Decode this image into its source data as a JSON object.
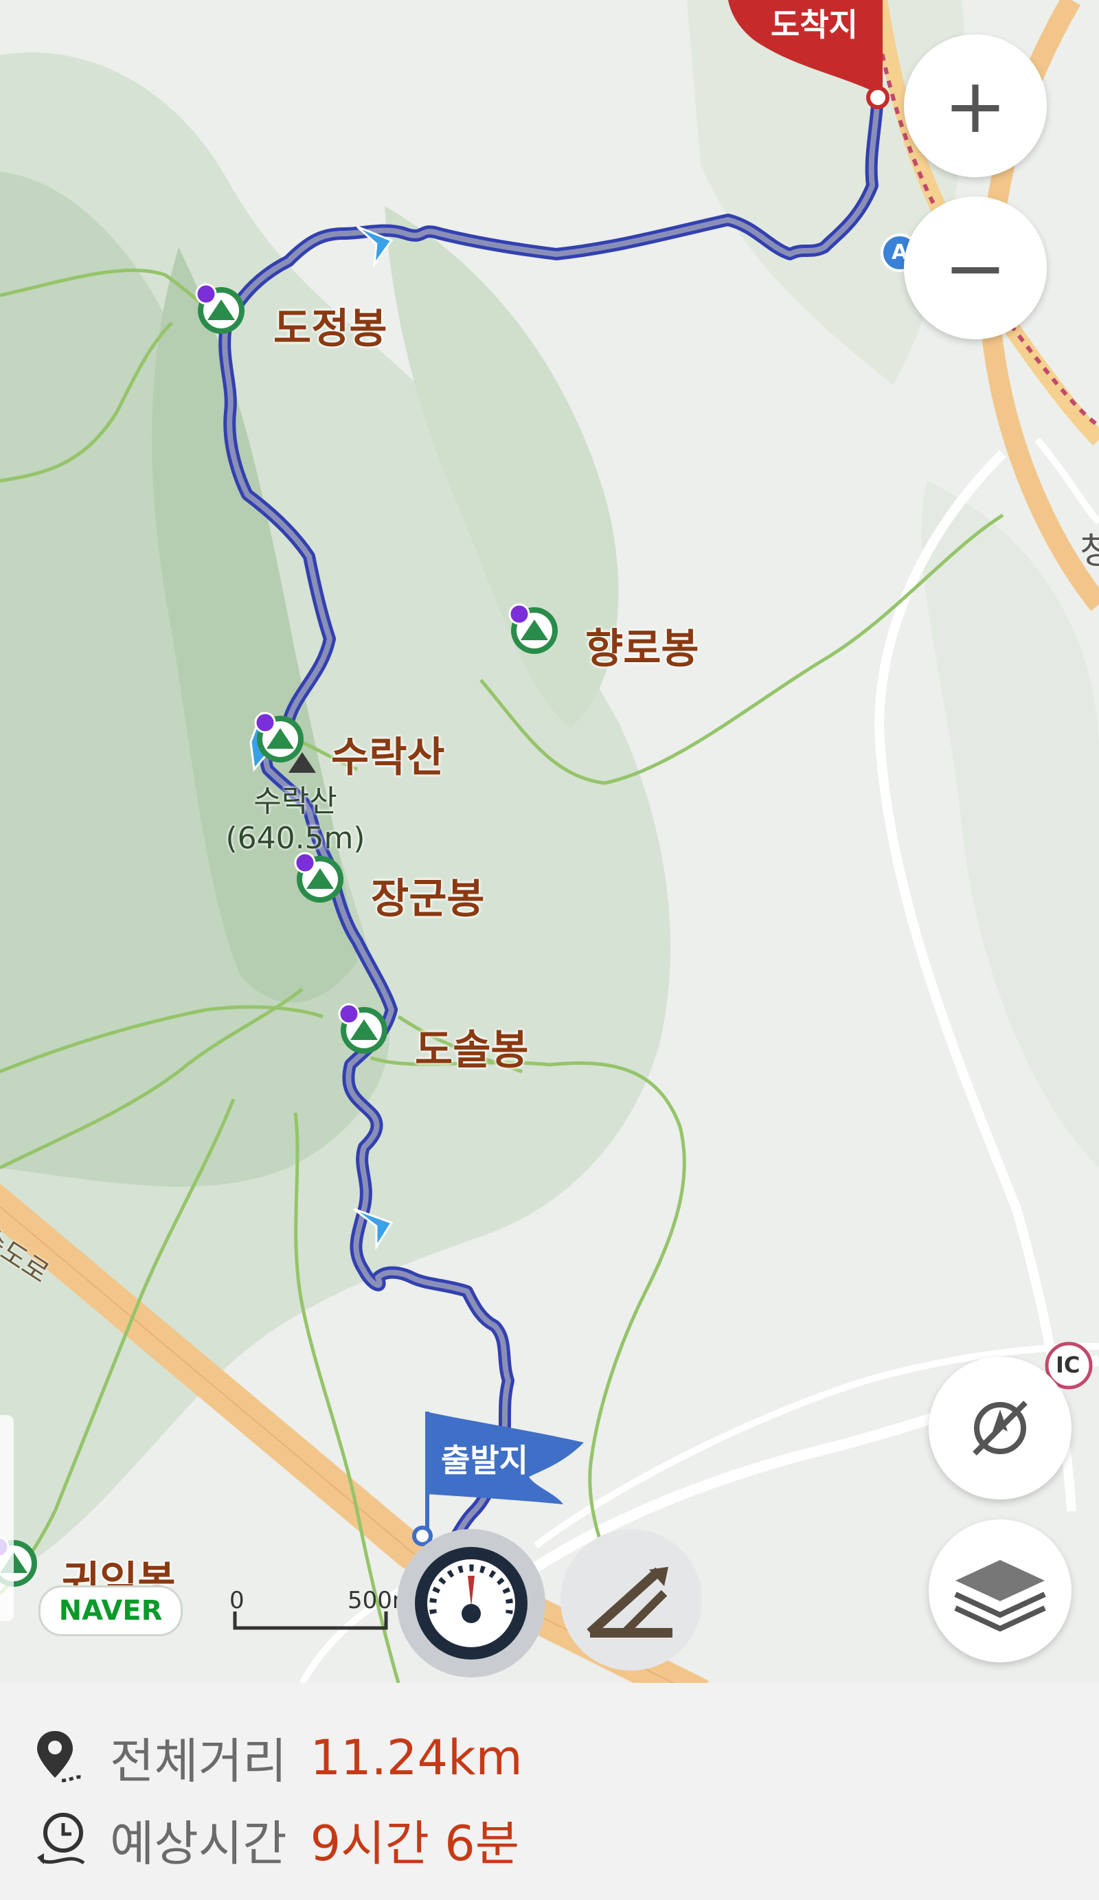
{
  "map": {
    "markers": {
      "start": "출발지",
      "end": "도착지"
    },
    "peaks": [
      "도정봉",
      "향로봉",
      "수락산",
      "장군봉",
      "도솔봉",
      "귀임봉"
    ],
    "summit_label": {
      "name": "수락산",
      "elevation": "(640.5m)"
    },
    "road_label": "속도로",
    "edge_label": "청",
    "route_sign": "A",
    "ic_label": "IC",
    "brand": "NAVER",
    "scale": {
      "start": "0",
      "end": "500m"
    }
  },
  "controls": {
    "zoom_in": "+",
    "zoom_out": "−",
    "icons": [
      "speedometer-icon",
      "incline-icon",
      "compass-off-icon",
      "layers-icon"
    ]
  },
  "summary": {
    "distance_label": "전체거리",
    "distance_value": "11.24km",
    "time_label": "예상시간",
    "time_value": "9시간 6분"
  },
  "colors": {
    "route": "#3340b0",
    "route_fill": "#8a8fb8",
    "accent": "#c53a16",
    "start_flag": "#3f6fc7",
    "end_flag": "#c62b2b",
    "trail": "#8cc45e",
    "highway": "#f5c98a"
  }
}
